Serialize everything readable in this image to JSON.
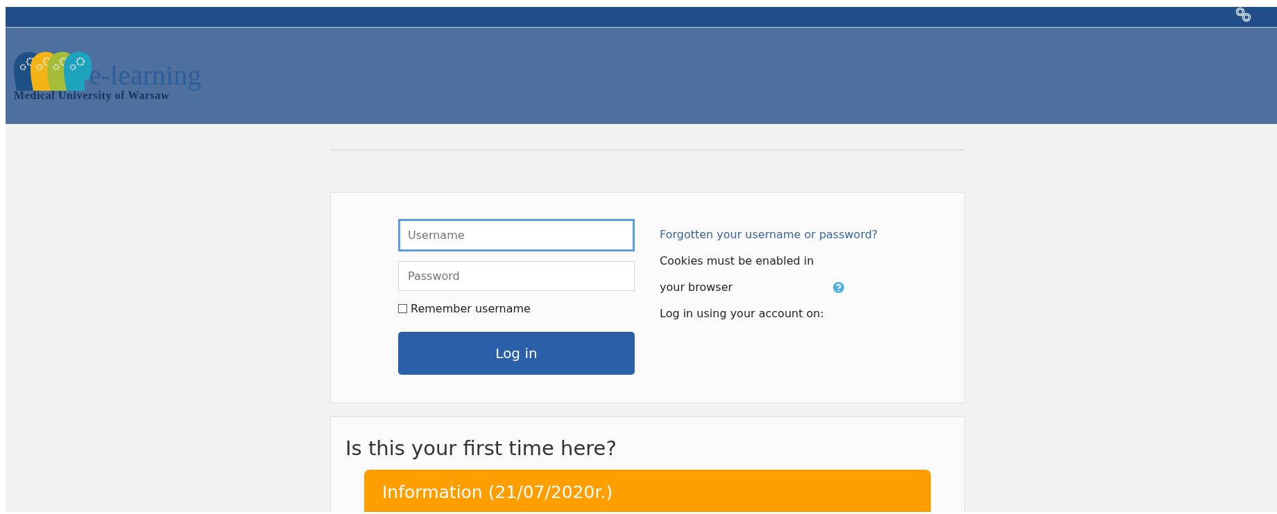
{
  "header": {
    "logo_title": "e-learning",
    "logo_subtitle": "Medical University of Warsaw"
  },
  "login": {
    "username": {
      "placeholder": "Username",
      "focused": true
    },
    "password": {
      "placeholder": "Password",
      "focused": false
    },
    "remember": {
      "label": "Remember username",
      "checked": false
    },
    "button": "Log in",
    "forgot_link": "Forgotten your username or password?",
    "cookies_note": "Cookies must be enabled in your browser",
    "other_login": "Log in using your account on:"
  },
  "first_time": {
    "heading": "Is this your first time here?",
    "notice_title": "Information (21/07/2020r.)"
  }
}
